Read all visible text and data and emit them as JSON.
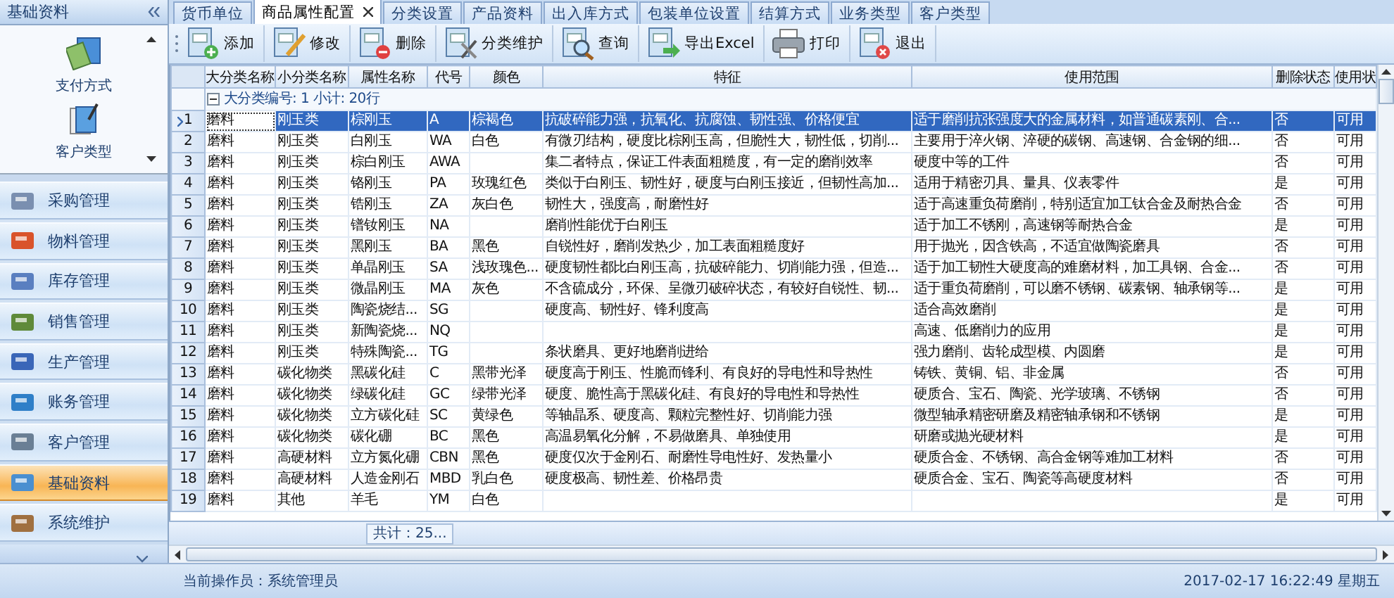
{
  "sidebar": {
    "title": "基础资料",
    "shortcuts": [
      {
        "label": "支付方式",
        "kind": "payment"
      },
      {
        "label": "客户类型",
        "kind": "customer-type"
      }
    ],
    "items": [
      {
        "label": "采购管理",
        "kind": "purchase",
        "selected": false
      },
      {
        "label": "物料管理",
        "kind": "material",
        "selected": false
      },
      {
        "label": "库存管理",
        "kind": "stock",
        "selected": false
      },
      {
        "label": "销售管理",
        "kind": "sales",
        "selected": false
      },
      {
        "label": "生产管理",
        "kind": "production",
        "selected": false
      },
      {
        "label": "账务管理",
        "kind": "finance",
        "selected": false
      },
      {
        "label": "客户管理",
        "kind": "customer",
        "selected": false
      },
      {
        "label": "基础资料",
        "kind": "basic",
        "selected": true
      },
      {
        "label": "系统维护",
        "kind": "system",
        "selected": false
      }
    ]
  },
  "tabs": [
    {
      "label": "货币单位",
      "selected": false
    },
    {
      "label": "商品属性配置",
      "selected": true
    },
    {
      "label": "分类设置",
      "selected": false
    },
    {
      "label": "产品资料",
      "selected": false
    },
    {
      "label": "出入库方式",
      "selected": false
    },
    {
      "label": "包装单位设置",
      "selected": false
    },
    {
      "label": "结算方式",
      "selected": false
    },
    {
      "label": "业务类型",
      "selected": false
    },
    {
      "label": "客户类型",
      "selected": false
    }
  ],
  "toolbar": [
    {
      "label": "添加",
      "kind": "add"
    },
    {
      "label": "修改",
      "kind": "edit"
    },
    {
      "label": "删除",
      "kind": "delete"
    },
    {
      "label": "分类维护",
      "kind": "category"
    },
    {
      "label": "查询",
      "kind": "search"
    },
    {
      "label": "导出Excel",
      "kind": "export"
    },
    {
      "label": "打印",
      "kind": "print"
    },
    {
      "label": "退出",
      "kind": "exit"
    }
  ],
  "table": {
    "columns": [
      "大分类名称",
      "小分类名称",
      "属性名称",
      "代号",
      "颜色",
      "特征",
      "使用范围",
      "删除状态",
      "使用状"
    ],
    "group": {
      "label": "大分类编号: 1  小计: 20行",
      "expanded": true
    },
    "rows": [
      {
        "number": "1",
        "selected": true,
        "cells": [
          "磨料",
          "刚玉类",
          "棕刚玉",
          "A",
          "棕褐色",
          "抗破碎能力强，抗氧化、抗腐蚀、韧性强、价格便宜",
          "适于磨削抗张强度大的金属材料，如普通碳素刚、合...",
          "否",
          "可用"
        ]
      },
      {
        "number": "2",
        "selected": false,
        "cells": [
          "磨料",
          "刚玉类",
          "白刚玉",
          "WA",
          "白色",
          "有微刃结构，硬度比棕刚玉高，但脆性大，韧性低，切削...",
          "主要用于淬火钢、淬硬的碳钢、高速钢、合金钢的细...",
          "否",
          "可用"
        ]
      },
      {
        "number": "3",
        "selected": false,
        "cells": [
          "磨料",
          "刚玉类",
          "棕白刚玉",
          "AWA",
          "",
          "集二者特点，保证工件表面粗糙度，有一定的磨削效率",
          "硬度中等的工件",
          "否",
          "可用"
        ]
      },
      {
        "number": "4",
        "selected": false,
        "cells": [
          "磨料",
          "刚玉类",
          "铬刚玉",
          "PA",
          "玫瑰红色",
          "类似于白刚玉、韧性好，硬度与白刚玉接近，但韧性高加...",
          "适用于精密刃具、量具、仪表零件",
          "是",
          "可用"
        ]
      },
      {
        "number": "5",
        "selected": false,
        "cells": [
          "磨料",
          "刚玉类",
          "锆刚玉",
          "ZA",
          "灰白色",
          "韧性大，强度高，耐磨性好",
          "适于高速重负荷磨削，特别适宜加工钛合金及耐热合金",
          "否",
          "可用"
        ]
      },
      {
        "number": "6",
        "selected": false,
        "cells": [
          "磨料",
          "刚玉类",
          "镨钕刚玉",
          "NA",
          "",
          "磨削性能优于白刚玉",
          "适于加工不锈刚，高速钢等耐热合金",
          "是",
          "可用"
        ]
      },
      {
        "number": "7",
        "selected": false,
        "cells": [
          "磨料",
          "刚玉类",
          "黑刚玉",
          "BA",
          "黑色",
          "自锐性好，磨削发热少，加工表面粗糙度好",
          "用于抛光，因含铁高，不适宜做陶瓷磨具",
          "否",
          "可用"
        ]
      },
      {
        "number": "8",
        "selected": false,
        "cells": [
          "磨料",
          "刚玉类",
          "单晶刚玉",
          "SA",
          "浅玫瑰色...",
          "硬度韧性都比白刚玉高，抗破碎能力、切削能力强，但造...",
          "适于加工韧性大硬度高的难磨材料，加工具钢、合金...",
          "否",
          "可用"
        ]
      },
      {
        "number": "9",
        "selected": false,
        "cells": [
          "磨料",
          "刚玉类",
          "微晶刚玉",
          "MA",
          "灰色",
          "不含硫成分，环保、呈微刃破碎状态，有较好自锐性、韧...",
          "适于重负荷磨削，可以磨不锈钢、碳素钢、轴承钢等...",
          "是",
          "可用"
        ]
      },
      {
        "number": "10",
        "selected": false,
        "cells": [
          "磨料",
          "刚玉类",
          "陶瓷烧结...",
          "SG",
          "",
          "硬度高、韧性好、锋利度高",
          "适合高效磨削",
          "是",
          "可用"
        ]
      },
      {
        "number": "11",
        "selected": false,
        "cells": [
          "磨料",
          "刚玉类",
          "新陶瓷烧...",
          "NQ",
          "",
          "",
          "高速、低磨削力的应用",
          "是",
          "可用"
        ]
      },
      {
        "number": "12",
        "selected": false,
        "cells": [
          "磨料",
          "刚玉类",
          "特殊陶瓷...",
          "TG",
          "",
          "条状磨具、更好地磨削进给",
          "强力磨削、齿轮成型模、内圆磨",
          "是",
          "可用"
        ]
      },
      {
        "number": "13",
        "selected": false,
        "cells": [
          "磨料",
          "碳化物类",
          "黑碳化硅",
          "C",
          "黑带光泽",
          "硬度高于刚玉、性脆而锋利、有良好的导电性和导热性",
          "铸铁、黄铜、铝、非金属",
          "否",
          "可用"
        ]
      },
      {
        "number": "14",
        "selected": false,
        "cells": [
          "磨料",
          "碳化物类",
          "绿碳化硅",
          "GC",
          "绿带光泽",
          "硬度、脆性高于黑碳化硅、有良好的导电性和导热性",
          "硬质合、宝石、陶瓷、光学玻璃、不锈钢",
          "否",
          "可用"
        ]
      },
      {
        "number": "15",
        "selected": false,
        "cells": [
          "磨料",
          "碳化物类",
          "立方碳化硅",
          "SC",
          "黄绿色",
          "等轴晶系、硬度高、颗粒完整性好、切削能力强",
          "微型轴承精密研磨及精密轴承钢和不锈钢",
          "是",
          "可用"
        ]
      },
      {
        "number": "16",
        "selected": false,
        "cells": [
          "磨料",
          "碳化物类",
          "碳化硼",
          "BC",
          "黑色",
          "高温易氧化分解，不易做磨具、单独使用",
          "研磨或抛光硬材料",
          "是",
          "可用"
        ]
      },
      {
        "number": "17",
        "selected": false,
        "cells": [
          "磨料",
          "高硬材料",
          "立方氮化硼",
          "CBN",
          "黑色",
          "硬度仅次于金刚石、耐磨性导电性好、发热量小",
          "硬质合金、不锈钢、高合金钢等难加工材料",
          "否",
          "可用"
        ]
      },
      {
        "number": "18",
        "selected": false,
        "cells": [
          "磨料",
          "高硬材料",
          "人造金刚石",
          "MBD",
          "乳白色",
          "硬度极高、韧性差、价格昂贵",
          "硬质合金、宝石、陶瓷等高硬度材料",
          "否",
          "可用"
        ]
      },
      {
        "number": "19",
        "selected": false,
        "cells": [
          "磨料",
          "其他",
          "羊毛",
          "YM",
          "白色",
          "",
          "",
          "是",
          "可用"
        ]
      }
    ],
    "summary": "共计：25..."
  },
  "status_bar": {
    "operator": "当前操作员：系统管理员",
    "datetime": "2017-02-17 16:22:49 星期五"
  }
}
